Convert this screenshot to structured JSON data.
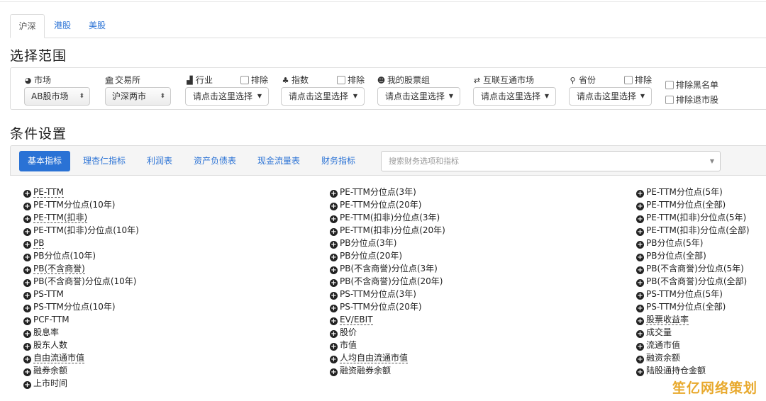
{
  "market_tabs": [
    "沪深",
    "港股",
    "美股"
  ],
  "titles": {
    "scope": "选择范围",
    "conditions": "条件设置"
  },
  "filters": {
    "market_label": "市场",
    "market_value": "AB股市场",
    "exchange_label": "交易所",
    "exchange_value": "沪深两市",
    "industry_label": "行业",
    "index_label": "指数",
    "mystock_label": "我的股票组",
    "connect_label": "互联互通市场",
    "province_label": "省份",
    "exclude_label": "排除",
    "select_placeholder": "请点击这里选择",
    "exclude_blacklist": "排除黑名单",
    "exclude_delisted": "排除退市股"
  },
  "cond_tabs": [
    "基本指标",
    "理杏仁指标",
    "利润表",
    "资产负债表",
    "现金流量表",
    "财务指标"
  ],
  "search_placeholder": "搜索财务选项和指标",
  "indicators": {
    "col1": [
      {
        "text": "PE-TTM",
        "dashed": true
      },
      {
        "text": "PE-TTM分位点(10年)",
        "dashed": false
      },
      {
        "text": "PE-TTM(扣非)",
        "dashed": true
      },
      {
        "text": "PE-TTM(扣非)分位点(10年)",
        "dashed": false
      },
      {
        "text": "PB",
        "dashed": true
      },
      {
        "text": "PB分位点(10年)",
        "dashed": false
      },
      {
        "text": "PB(不含商誉)",
        "dashed": true
      },
      {
        "text": "PB(不含商誉)分位点(10年)",
        "dashed": false
      },
      {
        "text": "PS-TTM",
        "dashed": false
      },
      {
        "text": "PS-TTM分位点(10年)",
        "dashed": false
      },
      {
        "text": "PCF-TTM",
        "dashed": false
      },
      {
        "text": "股息率",
        "dashed": false
      },
      {
        "text": "股东人数",
        "dashed": false
      },
      {
        "text": "自由流通市值",
        "dashed": true
      },
      {
        "text": "融券余额",
        "dashed": false
      },
      {
        "text": "上市时间",
        "dashed": false
      }
    ],
    "col2": [
      {
        "text": "PE-TTM分位点(3年)",
        "dashed": false
      },
      {
        "text": "PE-TTM分位点(20年)",
        "dashed": false
      },
      {
        "text": "PE-TTM(扣非)分位点(3年)",
        "dashed": false
      },
      {
        "text": "PE-TTM(扣非)分位点(20年)",
        "dashed": false
      },
      {
        "text": "PB分位点(3年)",
        "dashed": false
      },
      {
        "text": "PB分位点(20年)",
        "dashed": false
      },
      {
        "text": "PB(不含商誉)分位点(3年)",
        "dashed": false
      },
      {
        "text": "PB(不含商誉)分位点(20年)",
        "dashed": false
      },
      {
        "text": "PS-TTM分位点(3年)",
        "dashed": false
      },
      {
        "text": "PS-TTM分位点(20年)",
        "dashed": false
      },
      {
        "text": "EV/EBIT",
        "dashed": true
      },
      {
        "text": "股价",
        "dashed": false
      },
      {
        "text": "市值",
        "dashed": false
      },
      {
        "text": "人均自由流通市值",
        "dashed": true
      },
      {
        "text": "融资融券余额",
        "dashed": false
      }
    ],
    "col3": [
      {
        "text": "PE-TTM分位点(5年)",
        "dashed": false
      },
      {
        "text": "PE-TTM分位点(全部)",
        "dashed": false
      },
      {
        "text": "PE-TTM(扣非)分位点(5年)",
        "dashed": false
      },
      {
        "text": "PE-TTM(扣非)分位点(全部)",
        "dashed": false
      },
      {
        "text": "PB分位点(5年)",
        "dashed": false
      },
      {
        "text": "PB分位点(全部)",
        "dashed": false
      },
      {
        "text": "PB(不含商誉)分位点(5年)",
        "dashed": false
      },
      {
        "text": "PB(不含商誉)分位点(全部)",
        "dashed": false
      },
      {
        "text": "PS-TTM分位点(5年)",
        "dashed": false
      },
      {
        "text": "PS-TTM分位点(全部)",
        "dashed": false
      },
      {
        "text": "股票收益率",
        "dashed": true
      },
      {
        "text": "成交量",
        "dashed": false
      },
      {
        "text": "流通市值",
        "dashed": false
      },
      {
        "text": "融资余额",
        "dashed": false
      },
      {
        "text": "陆股通持仓金额",
        "dashed": false
      }
    ]
  },
  "watermark": "笙亿网络策划",
  "colors": {
    "accent": "#2a72d5",
    "watermark": "#e8a92d"
  }
}
